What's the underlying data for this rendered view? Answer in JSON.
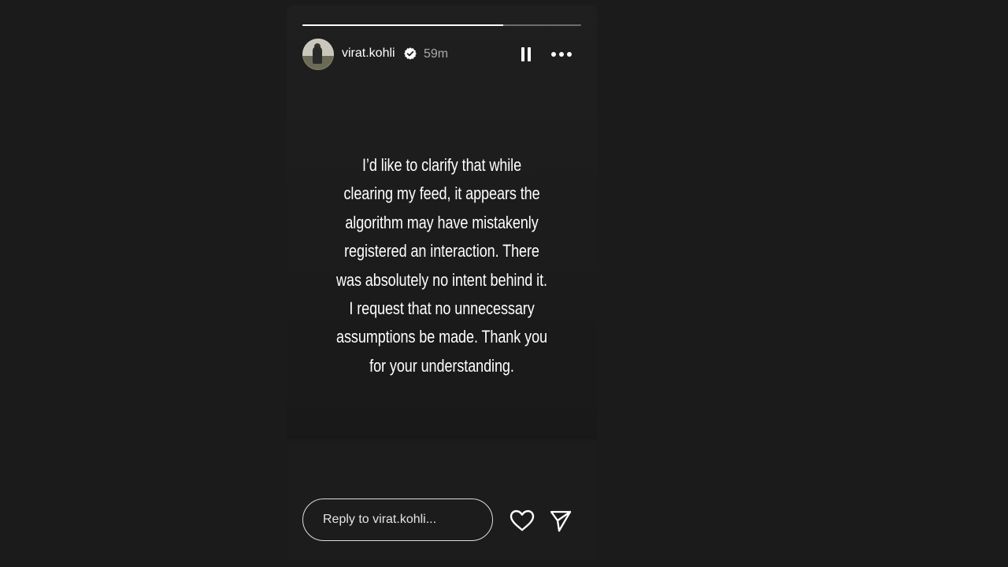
{
  "story": {
    "progress_fraction": 0.72,
    "author": {
      "username": "virat.kohli",
      "verified": true,
      "avatar_icon": "profile-photo-avatar"
    },
    "timestamp": "59m",
    "text_lines": [
      "I’d like to clarify that while",
      "clearing my feed, it appears the",
      "algorithm may have mistakenly",
      "registered an interaction. There",
      "was absolutely no intent behind it.",
      "I request that no unnecessary",
      "assumptions be made. Thank you",
      "for your understanding."
    ]
  },
  "controls": {
    "pause_icon": "pause-icon",
    "more_icon": "more-options-icon"
  },
  "reply": {
    "placeholder": "Reply to virat.kohli..."
  },
  "actions": {
    "like_icon": "heart-icon",
    "share_icon": "send-icon"
  },
  "colors": {
    "page_background": "#1b1b1b",
    "card_background": "#1c1c1c",
    "text": "#ffffff"
  }
}
